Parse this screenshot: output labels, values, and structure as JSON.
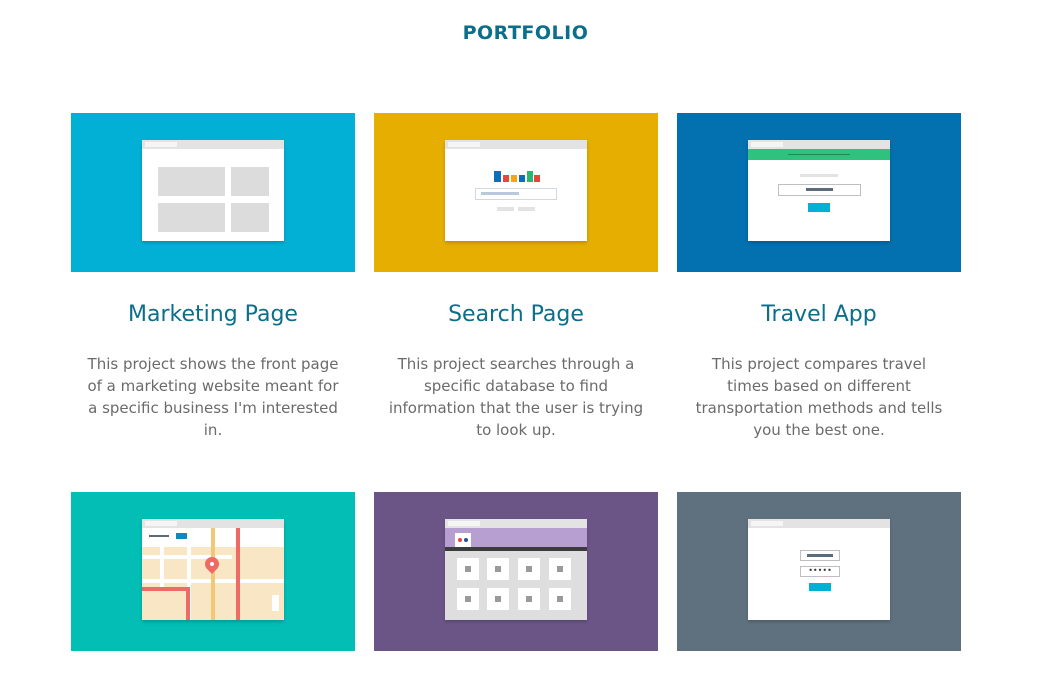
{
  "page": {
    "title": "PORTFOLIO"
  },
  "projects": [
    {
      "title": "Marketing Page",
      "description": "This project shows the front page of a marketing website meant for a specific business I'm interested in.",
      "color": "#03b0d5"
    },
    {
      "title": "Search Page",
      "description": "This project searches through a specific database to find information that the user is trying to look up.",
      "color": "#e6ae00"
    },
    {
      "title": "Travel App",
      "description": "This project compares travel times based on different transportation methods and tells you the best one.",
      "color": "#0370b0"
    },
    {
      "color": "#02beb5",
      "icon": "map-mockup"
    },
    {
      "color": "#6b5587",
      "icon": "gallery-mockup"
    },
    {
      "color": "#5f717e",
      "icon": "login-mockup"
    }
  ],
  "mockups": {
    "login_password_mask": "•••••"
  }
}
